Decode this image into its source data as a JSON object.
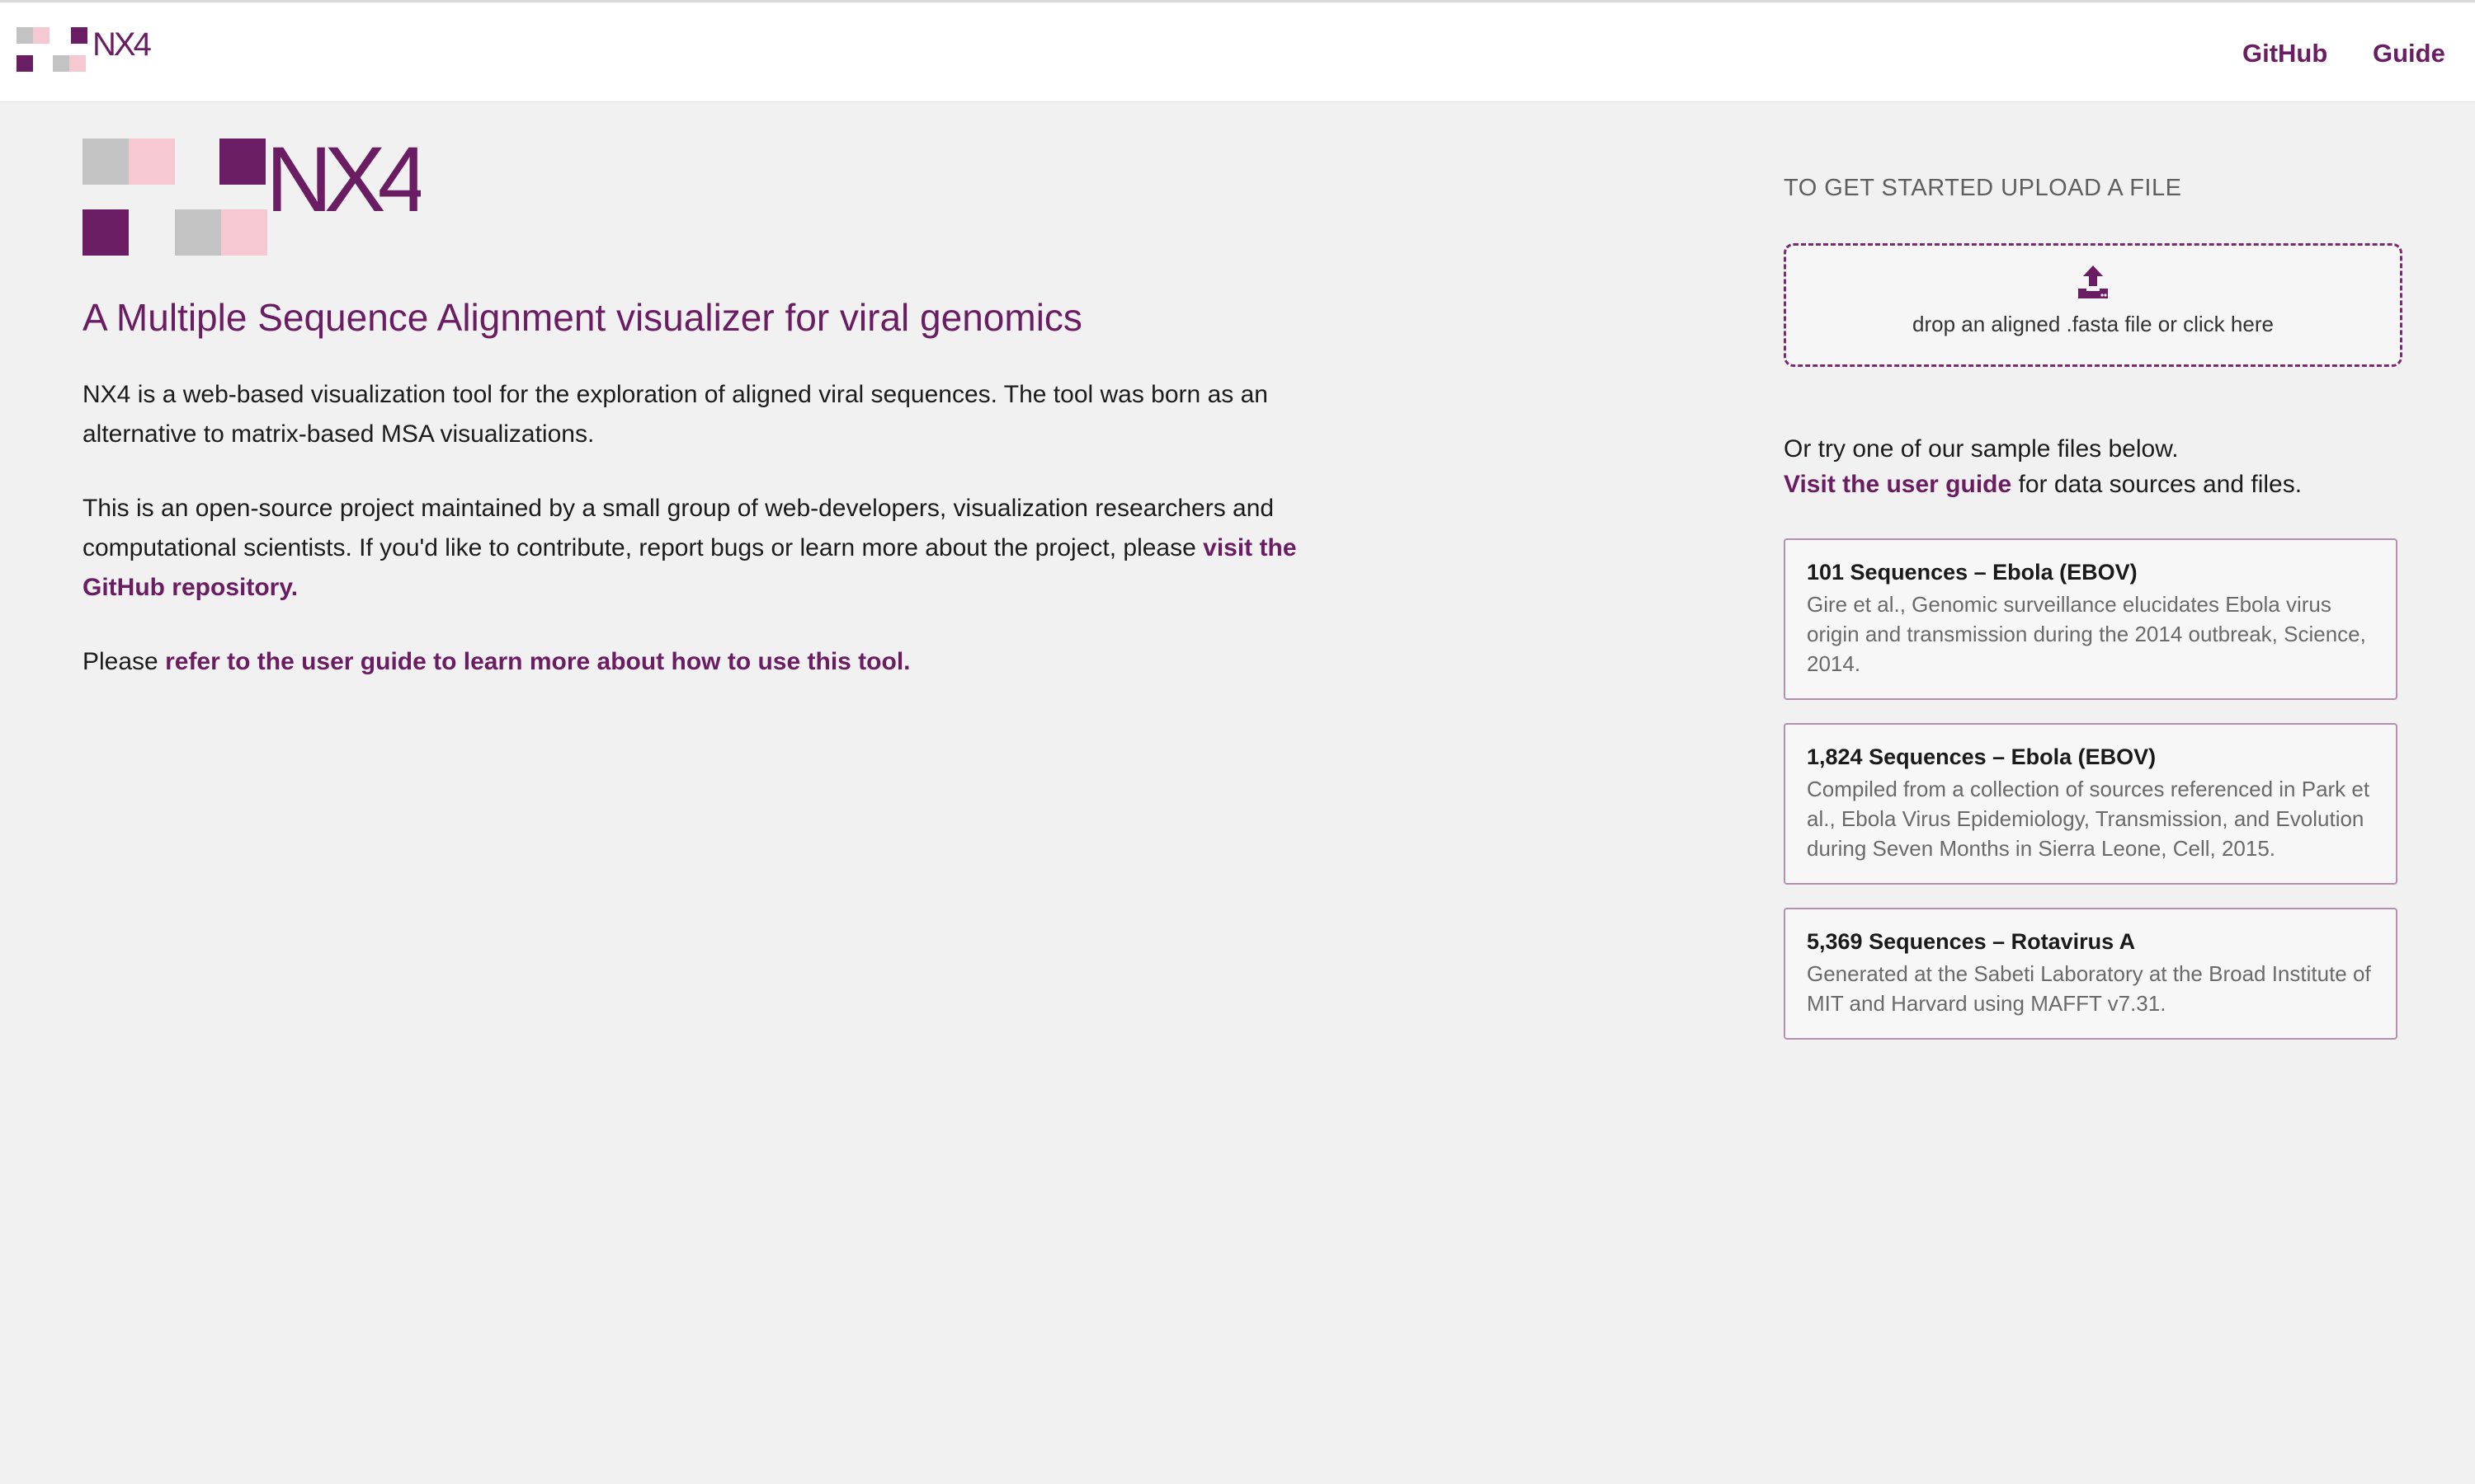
{
  "navbar": {
    "logo_text": "NX4",
    "links": [
      {
        "label": "GitHub"
      },
      {
        "label": "Guide"
      }
    ]
  },
  "hero": {
    "logo_text": "NX4",
    "tagline": "A Multiple Sequence Alignment visualizer for viral genomics",
    "para1": "NX4 is a web-based visualization tool for the exploration of aligned viral sequences. The tool was born as an alternative to matrix-based MSA visualizations.",
    "para2_text": "This is an open-source project maintained by a small group of web-developers, visualization researchers and computational scientists. If you'd like to contribute, report bugs or learn more about the project, please ",
    "para2_link": "visit the GitHub repository.",
    "para3_text": "Please ",
    "para3_link": "refer to the user guide to learn more about how to use this tool."
  },
  "upload": {
    "heading": "To get started upload a file",
    "dropzone_text": "drop an aligned .fasta file or click here",
    "icon": "upload-icon"
  },
  "samples": {
    "intro_line1": "Or try one of our sample files below.",
    "guide_link": "Visit the user guide",
    "intro_line2_rest": " for data sources and files.",
    "items": [
      {
        "title": "101 Sequences – Ebola (EBOV)",
        "description": "Gire et al., Genomic surveillance elucidates Ebola virus origin and transmission during the 2014 outbreak, Science, 2014."
      },
      {
        "title": "1,824 Sequences – Ebola (EBOV)",
        "description": "Compiled from a collection of sources referenced in Park et al., Ebola Virus Epidemiology, Transmission, and Evolution during Seven Months in Sierra Leone, Cell, 2015."
      },
      {
        "title": "5,369 Sequences – Rotavirus A",
        "description": "Generated at the Sabeti Laboratory at the Broad Institute of MIT and Harvard using MAFFT v7.31."
      }
    ]
  },
  "colors": {
    "brand_purple": "#6b1d63",
    "logo_gray": "#c3c3c3",
    "logo_pink": "#f5c8d2",
    "background": "#f1f1f1"
  }
}
